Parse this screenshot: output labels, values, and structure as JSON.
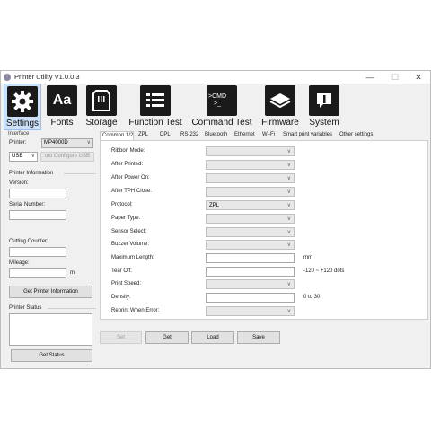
{
  "window": {
    "title": "Printer Utility  V1.0.0.3",
    "minimize": "—",
    "maximize": "☐",
    "close": "✕"
  },
  "toolbar": [
    {
      "label": "Settings",
      "icon": "gear-icon"
    },
    {
      "label": "Fonts",
      "icon_text": "Aa"
    },
    {
      "label": "Storage",
      "icon": "sd-card-icon"
    },
    {
      "label": "Function Test",
      "icon": "list-icon"
    },
    {
      "label": "Command Test",
      "icon_text": ">CMD\n>_"
    },
    {
      "label": "Firmware",
      "icon": "chip-icon"
    },
    {
      "label": "System",
      "icon": "system-icon"
    }
  ],
  "left": {
    "interface_label": "Interface",
    "printer_label": "Printer:",
    "printer_value": "MP4000D",
    "port_value": "USB",
    "usb_config_button": "uto Configure USB Pc",
    "info_label": "Printer Information",
    "version_label": "Version:",
    "serial_label": "Serial Number:",
    "cutting_label": "Cutting Counter:",
    "mileage_label": "Mileage:",
    "mileage_unit": "m",
    "get_info_button": "Get Printer Information",
    "status_label": "Printer Status",
    "get_status_button": "Get Status"
  },
  "tabs": [
    "Common 1/2",
    "ZPL",
    "DPL",
    "RS-232",
    "Bluetooth",
    "Ethernet",
    "Wi-Fi",
    "Smart print variables",
    "Other settings"
  ],
  "settings": [
    {
      "label": "Ribbon Mode:",
      "type": "combo",
      "value": "",
      "unit": ""
    },
    {
      "label": "After Printed:",
      "type": "combo",
      "value": "",
      "unit": ""
    },
    {
      "label": "After Power On:",
      "type": "combo",
      "value": "",
      "unit": ""
    },
    {
      "label": "After TPH Close:",
      "type": "combo",
      "value": "",
      "unit": ""
    },
    {
      "label": "Protocol:",
      "type": "combo",
      "value": "ZPL",
      "unit": ""
    },
    {
      "label": "Paper Type:",
      "type": "combo",
      "value": "",
      "unit": ""
    },
    {
      "label": "Sensor Select:",
      "type": "combo",
      "value": "",
      "unit": ""
    },
    {
      "label": "Buzzer Volume:",
      "type": "combo",
      "value": "",
      "unit": ""
    },
    {
      "label": "Maximum Length:",
      "type": "text",
      "value": "",
      "unit": "mm"
    },
    {
      "label": "Tear Off:",
      "type": "text",
      "value": "",
      "unit": "-120 ~ +120 dots"
    },
    {
      "label": "Print Speed:",
      "type": "combo",
      "value": "",
      "unit": ""
    },
    {
      "label": "Density:",
      "type": "text",
      "value": "",
      "unit": "0 to 30"
    },
    {
      "label": "Reprint When Error:",
      "type": "combo",
      "value": "",
      "unit": ""
    }
  ],
  "actions": [
    "Set",
    "Get",
    "Load",
    "Save"
  ]
}
